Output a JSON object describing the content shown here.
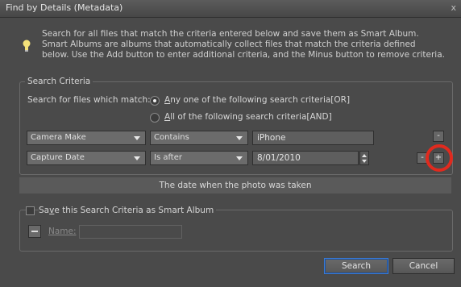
{
  "window": {
    "title": "Find by Details (Metadata)",
    "close_glyph": "x"
  },
  "info": {
    "icon": "lightbulb-icon",
    "text": "Search for all files that match the criteria entered below and save them as Smart Album. Smart Albums are albums that automatically collect files that match the criteria defined below. Use the Add button to enter additional criteria, and the Minus button to remove criteria."
  },
  "search_criteria": {
    "legend": "Search Criteria",
    "match_label": "Search for files which match:",
    "options": [
      {
        "label_prefix": "",
        "accel": "A",
        "label_rest": "ny one of the following search criteria[OR]",
        "selected": true
      },
      {
        "label_prefix": "",
        "accel": "A",
        "label_rest": "ll of the following search criteria[AND]",
        "selected": false
      }
    ],
    "rows": [
      {
        "field": "Camera Make",
        "operator": "Contains",
        "value": "iPhone"
      },
      {
        "field": "Capture Date",
        "operator": "Is after",
        "value": "8/01/2010"
      }
    ],
    "remove_label": "-",
    "add_label": "+",
    "hint": "The date when the photo was taken"
  },
  "smart_album": {
    "legend_prefix": "Sa",
    "legend_accel": "v",
    "legend_rest": "e this Search Criteria as Smart Album",
    "name_label": "Name:"
  },
  "buttons": {
    "search": "Search",
    "cancel": "Cancel"
  },
  "colors": {
    "highlight_ring": "#e02a1e",
    "background": "#4a4a4a"
  }
}
